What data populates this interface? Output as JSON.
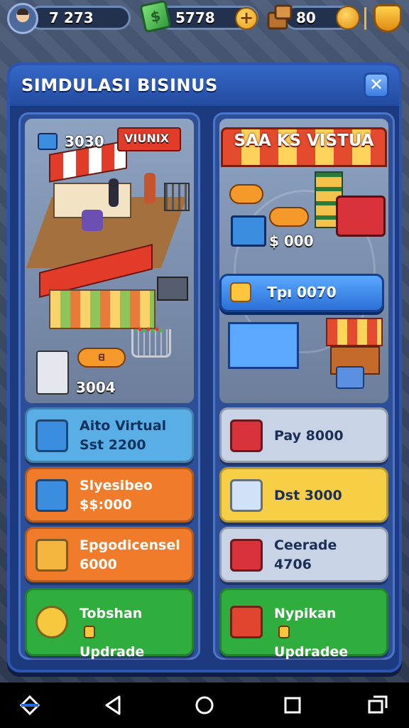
{
  "hud": {
    "player_value": "7 273",
    "cash_value": "5778",
    "crates_value": "80",
    "plus_label": "+"
  },
  "panel": {
    "title": "SIMDULASI BISINUS",
    "close_label": "✕"
  },
  "left": {
    "shop_price": "3030",
    "shop_sign": "VIUNIX",
    "bottom_tag": "ᗺ",
    "bottom_price": "3004",
    "cards": [
      {
        "line1": "Aito Virtual",
        "line2": "Sst 2200",
        "bg": "#5aaee6",
        "fg": "#12325e",
        "icon": "#3b8de0"
      },
      {
        "line1": "Slyesibeo",
        "line2": "$$:000",
        "bg": "#f07b2b",
        "fg": "#ffffff",
        "icon": "#3b8de0"
      },
      {
        "line1": "Epgodicensel",
        "line2": "6000",
        "bg": "#f07b2b",
        "fg": "#ffffff",
        "icon": "#f5b640"
      },
      {
        "line1": "Tobshan",
        "line2": "Updrade",
        "bg": "#2fae3d",
        "fg": "#ffffff",
        "icon": "#f5c83d"
      }
    ]
  },
  "right": {
    "banner": "SAA KS VISTUA",
    "tag1": "",
    "tag2": "",
    "price": "$ 000",
    "button_label": "Tpı 0070",
    "cards": [
      {
        "line1": "Pay 8000",
        "line2": "",
        "bg": "#c9d3e6",
        "fg": "#1b2e57",
        "icon": "#d8333a"
      },
      {
        "line1": "Dst 3000",
        "line2": "",
        "bg": "#f7cf47",
        "fg": "#1b2e57",
        "icon": "#cfe2f8"
      },
      {
        "line1": "Ceerade",
        "line2": "4706",
        "bg": "#c9d3e6",
        "fg": "#1b2e57",
        "icon": "#d8333a"
      },
      {
        "line1": "Nypikan",
        "line2": "Updradee",
        "bg": "#2fae3d",
        "fg": "#ffffff",
        "icon": "#e2452f"
      }
    ]
  },
  "colors": {
    "panel": "#1d3a7e",
    "accent_blue": "#2c70d6",
    "accent_orange": "#f07b2b",
    "accent_green": "#2fae3d",
    "accent_yellow": "#f7cf47"
  },
  "icons": {
    "nav": [
      "back-home-icon",
      "back-triangle-icon",
      "home-circle-icon",
      "recents-square-icon",
      "split-screen-icon"
    ]
  }
}
